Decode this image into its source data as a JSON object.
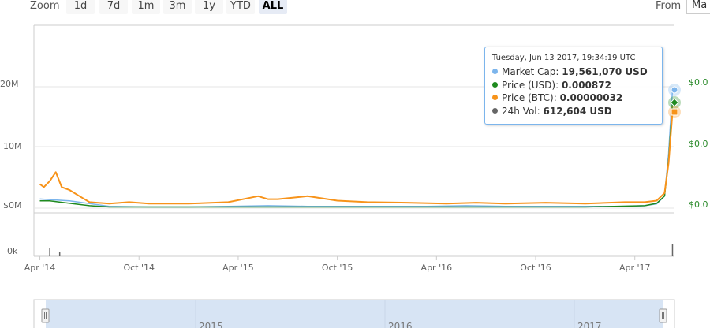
{
  "toolbar": {
    "zoom_label": "Zoom",
    "buttons": [
      "1d",
      "7d",
      "1m",
      "3m",
      "1y",
      "YTD",
      "ALL"
    ],
    "active_button": "ALL",
    "from_label": "From",
    "from_value": "Ma"
  },
  "tooltip": {
    "date": "Tuesday, Jun 13 2017, 19:34:19 UTC",
    "rows": [
      {
        "label": "Market Cap",
        "value": "19,561,070 USD",
        "color": "#7cb5ec"
      },
      {
        "label": "Price (USD)",
        "value": "0.000872",
        "color": "#1f8a1f"
      },
      {
        "label": "Price (BTC)",
        "value": "0.00000032",
        "color": "#f7931a"
      },
      {
        "label": "24h Vol",
        "value": "612,604 USD",
        "color": "#666666"
      }
    ]
  },
  "chart_data": {
    "type": "line",
    "x_ticks": [
      "Apr '14",
      "Oct '14",
      "Apr '15",
      "Oct '15",
      "Apr '16",
      "Oct '16",
      "Apr '17"
    ],
    "left_axis_ticks": [
      "20M",
      "10M",
      "$0M"
    ],
    "volume_axis_ticks": [
      "0k"
    ],
    "right_axis_ticks": [
      "$0.0",
      "$0.0",
      "$0.0"
    ],
    "navigator_labels": [
      "2015",
      "2016",
      "2017"
    ],
    "ylim": [
      0,
      30000000
    ],
    "series": [
      {
        "name": "Market Cap",
        "color": "#7cb5ec",
        "axis": "left",
        "x": [
          2014.25,
          2014.4,
          2014.6,
          2014.8,
          2015.0,
          2015.2,
          2015.4,
          2015.6,
          2015.8,
          2016.0,
          2016.2,
          2016.4,
          2016.6,
          2016.8,
          2017.0,
          2017.2,
          2017.3,
          2017.36,
          2017.4,
          2017.42,
          2017.44
        ],
        "values": [
          1500000,
          1200000,
          300000,
          200000,
          200000,
          300000,
          400000,
          300000,
          300000,
          300000,
          300000,
          400000,
          300000,
          300000,
          300000,
          300000,
          400000,
          700000,
          2000000,
          9000000,
          19561070
        ]
      },
      {
        "name": "Price (USD)",
        "color": "#1f8a1f",
        "axis": "right",
        "x": [
          2014.25,
          2014.3,
          2014.4,
          2014.5,
          2014.6,
          2014.8,
          2015.0,
          2015.4,
          2015.8,
          2016.2,
          2016.6,
          2017.0,
          2017.3,
          2017.36,
          2017.4,
          2017.42,
          2017.44
        ],
        "values": [
          6e-05,
          6e-05,
          4e-05,
          2e-05,
          1e-05,
          1e-05,
          1e-05,
          1e-05,
          1e-05,
          1e-05,
          1e-05,
          1e-05,
          2e-05,
          4e-05,
          0.0001,
          0.0004,
          0.000872
        ]
      },
      {
        "name": "Price (BTC)",
        "color": "#f7931a",
        "axis": "right",
        "x": [
          2014.25,
          2014.27,
          2014.3,
          2014.33,
          2014.36,
          2014.4,
          2014.45,
          2014.5,
          2014.6,
          2014.7,
          2014.8,
          2015.0,
          2015.2,
          2015.35,
          2015.4,
          2015.45,
          2015.6,
          2015.75,
          2015.9,
          2016.1,
          2016.3,
          2016.45,
          2016.6,
          2016.8,
          2017.0,
          2017.2,
          2017.3,
          2017.36,
          2017.4,
          2017.42,
          2017.44
        ],
        "values": [
          8e-08,
          7e-08,
          9e-08,
          1.2e-07,
          7e-08,
          6e-08,
          4e-08,
          2e-08,
          1.5e-08,
          2e-08,
          1.5e-08,
          1.5e-08,
          2e-08,
          4e-08,
          3e-08,
          3e-08,
          4e-08,
          2.5e-08,
          2e-08,
          1.8e-08,
          1.5e-08,
          1.8e-08,
          1.5e-08,
          1.8e-08,
          1.5e-08,
          2e-08,
          2e-08,
          2.5e-08,
          5e-08,
          1.5e-07,
          3.2e-07
        ]
      },
      {
        "name": "24h Vol",
        "color": "#666666",
        "axis": "volume",
        "x": [
          2014.3,
          2014.35,
          2017.44
        ],
        "values": [
          400000,
          200000,
          612604
        ]
      }
    ]
  }
}
